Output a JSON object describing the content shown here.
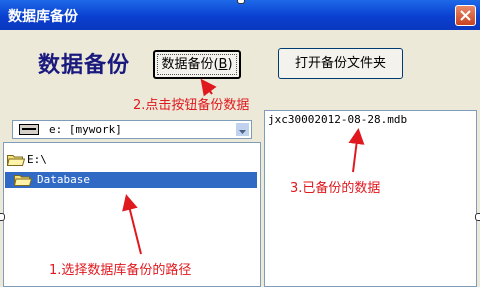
{
  "window": {
    "title": "数据库备份"
  },
  "heading": "数据备份",
  "buttons": {
    "backup": "数据备份",
    "backup_shortcut": "B",
    "open_folder": "打开备份文件夹"
  },
  "drive_select": {
    "value": "e: [mywork]"
  },
  "directory_tree": [
    "E:\\",
    "Database"
  ],
  "file_list": [
    "jxc30002012-08-28.mdb"
  ],
  "annotations": {
    "step1": "1.选择数据库备份的路径",
    "step2": "2.点击按钮备份数据",
    "step3": "3.已备份的数据"
  },
  "colors": {
    "annotation": "#E0191F",
    "heading": "#1A1A7E",
    "selection": "#316AC5"
  }
}
